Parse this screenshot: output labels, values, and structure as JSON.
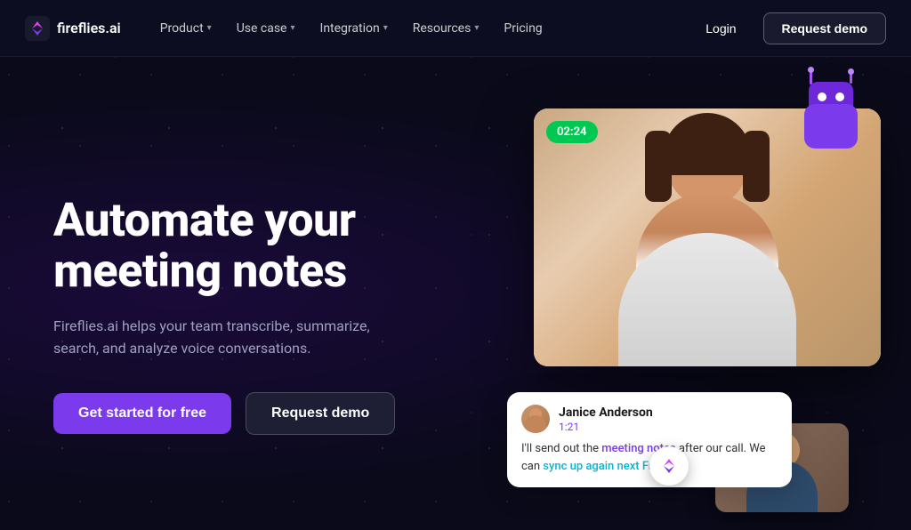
{
  "brand": {
    "name": "fireflies.ai",
    "logo_label": "F"
  },
  "nav": {
    "items": [
      {
        "label": "Product",
        "has_dropdown": true
      },
      {
        "label": "Use case",
        "has_dropdown": true
      },
      {
        "label": "Integration",
        "has_dropdown": true
      },
      {
        "label": "Resources",
        "has_dropdown": true
      },
      {
        "label": "Pricing",
        "has_dropdown": false
      }
    ],
    "login_label": "Login",
    "request_demo_label": "Request demo"
  },
  "hero": {
    "title": "Automate your meeting notes",
    "subtitle": "Fireflies.ai helps your team transcribe, summarize, search, and analyze voice conversations.",
    "cta_primary": "Get started for free",
    "cta_secondary": "Request demo"
  },
  "video_ui": {
    "timer": "02:24",
    "chat": {
      "name": "Janice Anderson",
      "time": "1:21",
      "message_plain": "I'll send out the ",
      "highlight1": "meeting notes",
      "message_mid": " after our call. We can ",
      "highlight2": "sync up again next Friday.",
      "message_end": ""
    },
    "center_logo": "F"
  }
}
